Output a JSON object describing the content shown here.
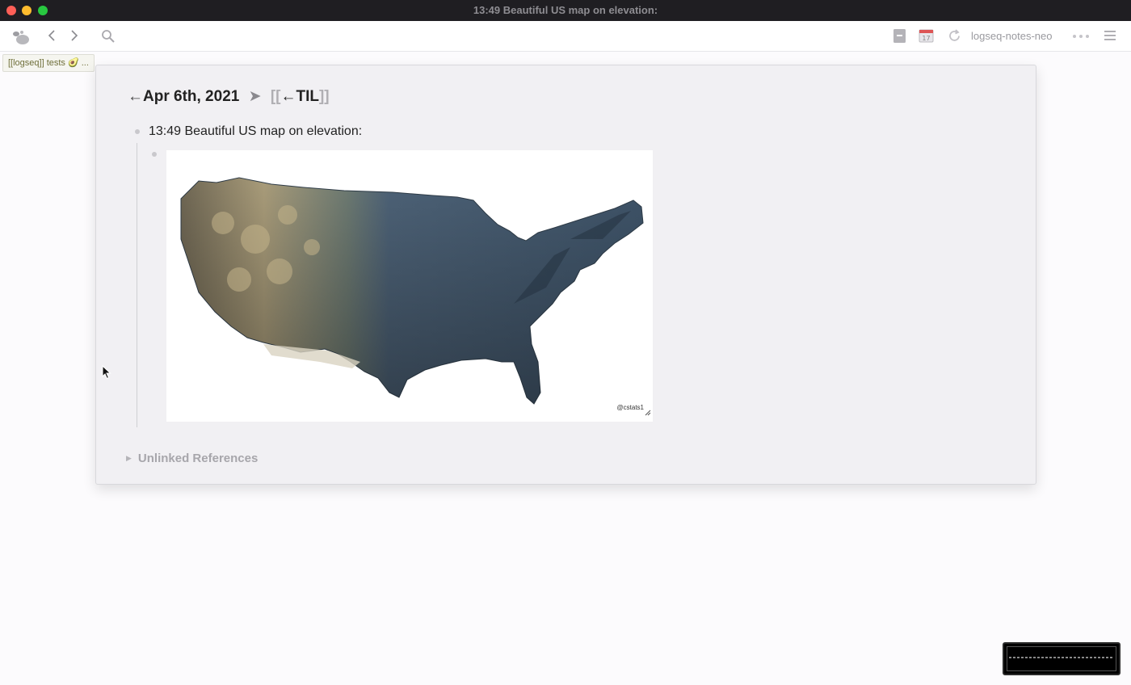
{
  "window": {
    "title": "13:49 Beautiful US map on elevation:"
  },
  "toolbar": {
    "repo_name": "logseq-notes-neo"
  },
  "tab": {
    "label": "[[logseq]] tests 🥑  ..."
  },
  "page": {
    "journal_title": "Apr 6th, 2021",
    "arrow_left": "←",
    "separator": "➤",
    "link_open": "[[",
    "link_text": "←TIL",
    "link_close": "]]",
    "block_text": "13:49 Beautiful US map on elevation:",
    "image_credit": "@cstats1",
    "unlinked_references": "Unlinked References"
  },
  "colors": {
    "accent": "#6f6f3a",
    "titlebar": "#1f1e22",
    "panel": "#f1f0f3"
  }
}
